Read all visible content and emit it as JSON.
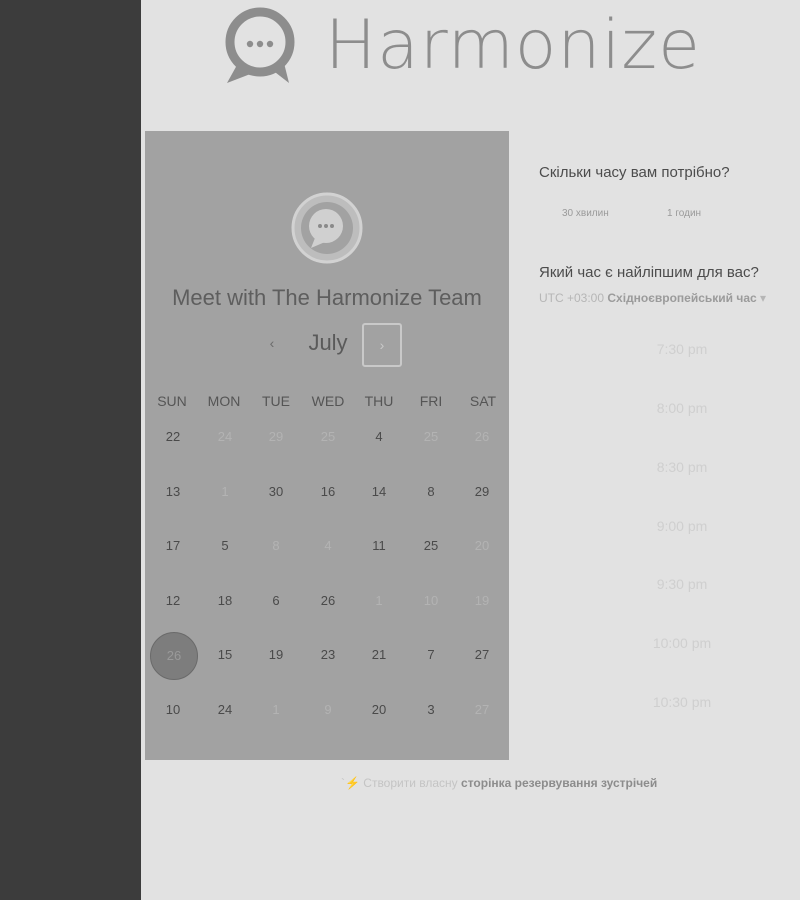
{
  "brand": {
    "name": "Harmonize"
  },
  "calendar": {
    "title": "Meet with The Harmonize Team",
    "month": "July",
    "prev_symbol": "‹",
    "next_symbol": "›",
    "weekdays": [
      "SUN",
      "MON",
      "TUE",
      "WED",
      "THU",
      "FRI",
      "SAT"
    ],
    "weeks": [
      [
        {
          "d": "22",
          "s": "enabled"
        },
        {
          "d": "24",
          "s": "disabled"
        },
        {
          "d": "29",
          "s": "disabled"
        },
        {
          "d": "25",
          "s": "disabled"
        },
        {
          "d": "4",
          "s": "enabled"
        },
        {
          "d": "25",
          "s": "disabled"
        },
        {
          "d": "26",
          "s": "disabled"
        }
      ],
      [
        {
          "d": "13",
          "s": "enabled"
        },
        {
          "d": "1",
          "s": "disabled"
        },
        {
          "d": "30",
          "s": "enabled"
        },
        {
          "d": "16",
          "s": "enabled"
        },
        {
          "d": "14",
          "s": "enabled"
        },
        {
          "d": "8",
          "s": "enabled"
        },
        {
          "d": "29",
          "s": "enabled"
        }
      ],
      [
        {
          "d": "17",
          "s": "enabled"
        },
        {
          "d": "5",
          "s": "enabled"
        },
        {
          "d": "8",
          "s": "disabled"
        },
        {
          "d": "4",
          "s": "disabled"
        },
        {
          "d": "11",
          "s": "enabled"
        },
        {
          "d": "25",
          "s": "enabled"
        },
        {
          "d": "20",
          "s": "disabled"
        }
      ],
      [
        {
          "d": "12",
          "s": "enabled"
        },
        {
          "d": "18",
          "s": "enabled"
        },
        {
          "d": "6",
          "s": "enabled"
        },
        {
          "d": "26",
          "s": "enabled"
        },
        {
          "d": "1",
          "s": "disabled"
        },
        {
          "d": "10",
          "s": "disabled"
        },
        {
          "d": "19",
          "s": "disabled"
        }
      ],
      [
        {
          "d": "26",
          "s": "selected"
        },
        {
          "d": "15",
          "s": "enabled"
        },
        {
          "d": "19",
          "s": "enabled"
        },
        {
          "d": "23",
          "s": "enabled"
        },
        {
          "d": "21",
          "s": "enabled"
        },
        {
          "d": "7",
          "s": "enabled"
        },
        {
          "d": "27",
          "s": "enabled"
        }
      ],
      [
        {
          "d": "10",
          "s": "enabled"
        },
        {
          "d": "24",
          "s": "enabled"
        },
        {
          "d": "1",
          "s": "disabled"
        },
        {
          "d": "9",
          "s": "disabled"
        },
        {
          "d": "20",
          "s": "enabled"
        },
        {
          "d": "3",
          "s": "enabled"
        },
        {
          "d": "27",
          "s": "disabled"
        }
      ]
    ]
  },
  "duration": {
    "question": "Скільки часу вам потрібно?",
    "options": [
      "30 хвилин",
      "1 годин"
    ]
  },
  "time": {
    "question": "Який час є найліпшим для вас?",
    "timezone_offset": "UTC +03:00",
    "timezone_name": "Східноєвропейський час",
    "timezone_caret": "▾",
    "slots": [
      "7:30 pm",
      "8:00 pm",
      "8:30 pm",
      "9:00 pm",
      "9:30 pm",
      "10:00 pm",
      "10:30 pm"
    ]
  },
  "footer": {
    "icon_glyph": "`⚡",
    "prefix": "Створити власну ",
    "link": "сторінка резервування зустрічей"
  },
  "colors": {
    "sidebar": "#3c3c3c",
    "background": "#e2e2e2",
    "card": "#a2a2a2",
    "logo_gray": "#8d8d8d"
  }
}
